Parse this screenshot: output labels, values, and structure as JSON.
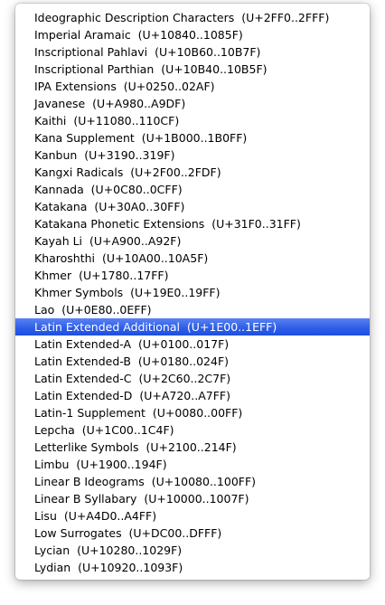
{
  "menu": {
    "selected_index": 18,
    "items": [
      {
        "label": "Ideographic Description Characters  (U+2FF0..2FFF)"
      },
      {
        "label": "Imperial Aramaic  (U+10840..1085F)"
      },
      {
        "label": "Inscriptional Pahlavi  (U+10B60..10B7F)"
      },
      {
        "label": "Inscriptional Parthian  (U+10B40..10B5F)"
      },
      {
        "label": "IPA Extensions  (U+0250..02AF)"
      },
      {
        "label": "Javanese  (U+A980..A9DF)"
      },
      {
        "label": "Kaithi  (U+11080..110CF)"
      },
      {
        "label": "Kana Supplement  (U+1B000..1B0FF)"
      },
      {
        "label": "Kanbun  (U+3190..319F)"
      },
      {
        "label": "Kangxi Radicals  (U+2F00..2FDF)"
      },
      {
        "label": "Kannada  (U+0C80..0CFF)"
      },
      {
        "label": "Katakana  (U+30A0..30FF)"
      },
      {
        "label": "Katakana Phonetic Extensions  (U+31F0..31FF)"
      },
      {
        "label": "Kayah Li  (U+A900..A92F)"
      },
      {
        "label": "Kharoshthi  (U+10A00..10A5F)"
      },
      {
        "label": "Khmer  (U+1780..17FF)"
      },
      {
        "label": "Khmer Symbols  (U+19E0..19FF)"
      },
      {
        "label": "Lao  (U+0E80..0EFF)"
      },
      {
        "label": "Latin Extended Additional  (U+1E00..1EFF)"
      },
      {
        "label": "Latin Extended-A  (U+0100..017F)"
      },
      {
        "label": "Latin Extended-B  (U+0180..024F)"
      },
      {
        "label": "Latin Extended-C  (U+2C60..2C7F)"
      },
      {
        "label": "Latin Extended-D  (U+A720..A7FF)"
      },
      {
        "label": "Latin-1 Supplement  (U+0080..00FF)"
      },
      {
        "label": "Lepcha  (U+1C00..1C4F)"
      },
      {
        "label": "Letterlike Symbols  (U+2100..214F)"
      },
      {
        "label": "Limbu  (U+1900..194F)"
      },
      {
        "label": "Linear B Ideograms  (U+10080..100FF)"
      },
      {
        "label": "Linear B Syllabary  (U+10000..1007F)"
      },
      {
        "label": "Lisu  (U+A4D0..A4FF)"
      },
      {
        "label": "Low Surrogates  (U+DC00..DFFF)"
      },
      {
        "label": "Lycian  (U+10280..1029F)"
      },
      {
        "label": "Lydian  (U+10920..1093F)"
      }
    ]
  },
  "colors": {
    "selection": "#2f5fe8",
    "text": "#000000",
    "selected_text": "#ffffff"
  }
}
